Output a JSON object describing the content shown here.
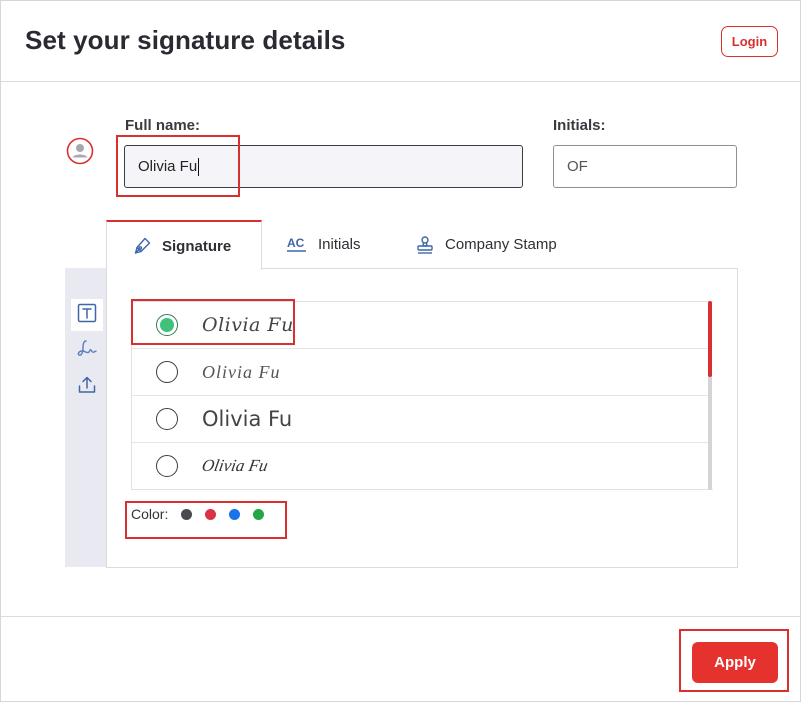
{
  "header": {
    "title": "Set your signature details",
    "login_label": "Login"
  },
  "form": {
    "full_name_label": "Full name:",
    "full_name_value": "Olivia Fu",
    "initials_label": "Initials:",
    "initials_value": "OF"
  },
  "tabs": [
    {
      "label": "Signature",
      "icon": "pen-icon",
      "active": true
    },
    {
      "label": "Initials",
      "icon": "ac-icon",
      "active": false
    },
    {
      "label": "Company Stamp",
      "icon": "stamp-icon",
      "active": false
    }
  ],
  "side_tools": [
    {
      "icon": "text-type-icon",
      "active": true
    },
    {
      "icon": "draw-signature-icon",
      "active": false
    },
    {
      "icon": "upload-icon",
      "active": false
    }
  ],
  "signature_options": [
    {
      "text": "Olivia Fu",
      "selected": true
    },
    {
      "text": "Olivia Fu",
      "selected": false
    },
    {
      "text": "Olivia Fu",
      "selected": false
    },
    {
      "text": "Olivia Fu",
      "selected": false
    }
  ],
  "color": {
    "label": "Color:",
    "options": [
      "#4a4a4f",
      "#dc3242",
      "#1a73e8",
      "#27a744"
    ]
  },
  "footer": {
    "apply_label": "Apply"
  }
}
